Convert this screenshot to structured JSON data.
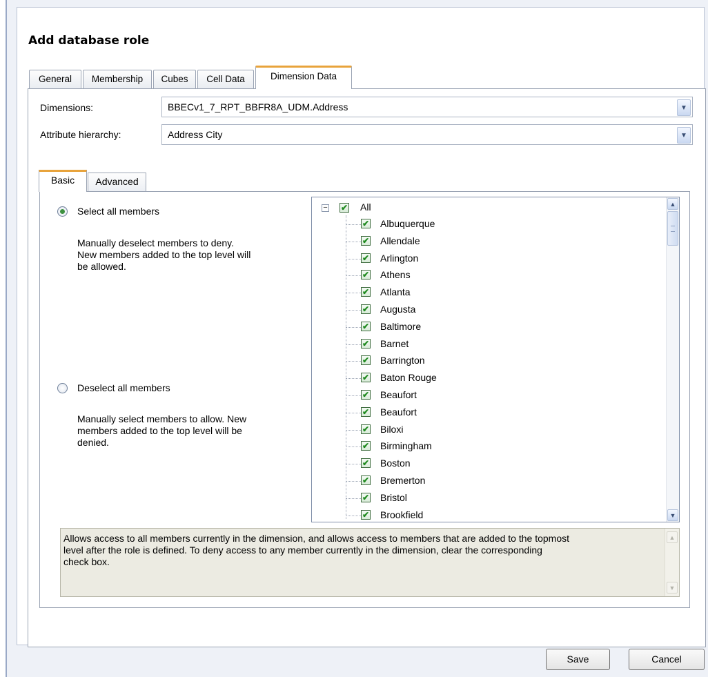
{
  "dialog": {
    "title": "Add database role",
    "tabs": [
      {
        "label": "General",
        "active": false
      },
      {
        "label": "Membership",
        "active": false
      },
      {
        "label": "Cubes",
        "active": false
      },
      {
        "label": "Cell Data",
        "active": false
      },
      {
        "label": "Dimension Data",
        "active": true
      }
    ]
  },
  "dimension_data": {
    "dimensions_label": "Dimensions:",
    "dimensions_value": "BBECv1_7_RPT_BBFR8A_UDM.Address",
    "attribute_label": "Attribute hierarchy:",
    "attribute_value": "Address City",
    "subtabs": [
      {
        "label": "Basic",
        "active": true
      },
      {
        "label": "Advanced",
        "active": false
      }
    ],
    "select_all": {
      "label": "Select all members",
      "selected": true,
      "note": [
        "Manually deselect members to deny.",
        "New members added to the top level will",
        "be allowed."
      ]
    },
    "deselect_all": {
      "label": "Deselect all members",
      "selected": false,
      "note": [
        "Manually select members to allow.  New",
        "members added to the top level will be",
        "denied."
      ]
    },
    "tree": {
      "root_label": "All",
      "root_expander": "−",
      "root_checked": true,
      "items": [
        "Albuquerque",
        "Allendale",
        "Arlington",
        "Athens",
        "Atlanta",
        "Augusta",
        "Baltimore",
        "Barnet",
        "Barrington",
        "Baton Rouge",
        "Beaufort",
        "Beaufort",
        "Biloxi",
        "Birmingham",
        "Boston",
        "Bremerton",
        "Bristol",
        "Brookfield"
      ]
    },
    "description": [
      "Allows access to all members currently in the dimension, and allows access to members that are added to the topmost",
      "level after the role is defined.  To deny access to any member currently in the dimension, clear the corresponding",
      "check box."
    ]
  },
  "buttons": {
    "save": "Save",
    "cancel": "Cancel"
  },
  "icons": {
    "check": "✔",
    "dropdown": "chevron-down-icon",
    "scroll_up": "scroll-up-arrow-icon",
    "scroll_down": "scroll-down-arrow-icon"
  },
  "colors": {
    "active_tab_accent": "#e8a33b",
    "check_green": "#1f8a1f",
    "window_bg": "#eef1f7"
  }
}
